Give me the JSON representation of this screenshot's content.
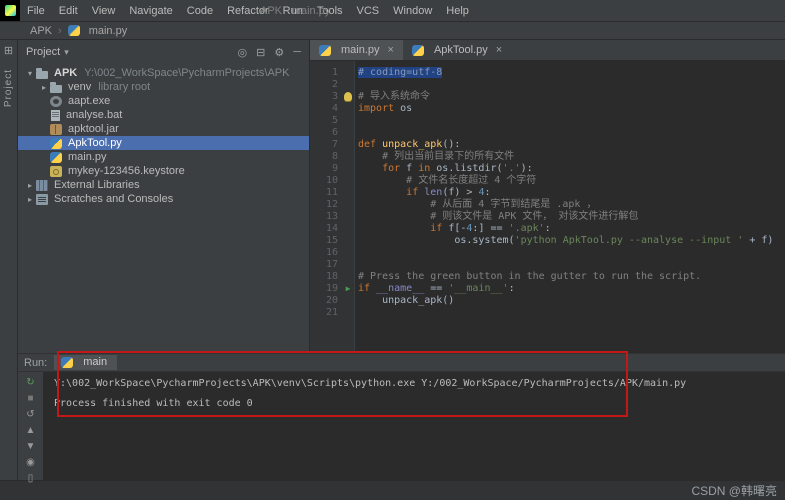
{
  "titlebar": {
    "menus": [
      "File",
      "Edit",
      "View",
      "Navigate",
      "Code",
      "Refactor",
      "Run",
      "Tools",
      "VCS",
      "Window",
      "Help"
    ],
    "title": "APK - main.py"
  },
  "breadcrumb": {
    "items": [
      {
        "label": "APK",
        "icon": null
      },
      {
        "label": "main.py",
        "icon": "python-icon"
      }
    ]
  },
  "toolstrip": {
    "project_label": "Project",
    "tool_windows_glyph": "⊞"
  },
  "project": {
    "title": "Project",
    "caret": "▾",
    "header_icons": [
      {
        "name": "locate-file-icon",
        "glyph": "◎"
      },
      {
        "name": "collapse-all-icon",
        "glyph": "⊟"
      },
      {
        "name": "settings-gear-icon",
        "glyph": "⚙"
      },
      {
        "name": "hide-panel-icon",
        "glyph": "─"
      }
    ],
    "tree": [
      {
        "indent": 0,
        "expand": "▾",
        "icon": "folder",
        "label": "APK",
        "sublabel": "Y:\\002_WorkSpace\\PycharmProjects\\APK",
        "bold": true
      },
      {
        "indent": 1,
        "expand": "▸",
        "icon": "folder",
        "label": "venv",
        "sublabel": "library root"
      },
      {
        "indent": 1,
        "expand": "",
        "icon": "exe",
        "label": "aapt.exe"
      },
      {
        "indent": 1,
        "expand": "",
        "icon": "doc",
        "label": "analyse.bat"
      },
      {
        "indent": 1,
        "expand": "",
        "icon": "jar",
        "label": "apktool.jar"
      },
      {
        "indent": 1,
        "expand": "",
        "icon": "py",
        "label": "ApkTool.py",
        "selected": true
      },
      {
        "indent": 1,
        "expand": "",
        "icon": "py",
        "label": "main.py"
      },
      {
        "indent": 1,
        "expand": "",
        "icon": "key",
        "label": "mykey-123456.keystore"
      },
      {
        "indent": 0,
        "expand": "▸",
        "icon": "lib",
        "label": "External Libraries"
      },
      {
        "indent": 0,
        "expand": "▸",
        "icon": "scratch",
        "label": "Scratches and Consoles"
      }
    ]
  },
  "editor": {
    "tabs": [
      {
        "label": "main.py",
        "icon": "python-icon",
        "active": true,
        "close": "×"
      },
      {
        "label": "ApkTool.py",
        "icon": "python-icon",
        "active": false,
        "close": "×"
      }
    ],
    "markers": {
      "bulb_line": 3,
      "run_line": 19,
      "run_glyph": "▶"
    },
    "lines": [
      [
        [
          "csel",
          "# coding=utf-8"
        ]
      ],
      [],
      [
        [
          "c",
          "# 导入系统命令"
        ]
      ],
      [
        [
          "k",
          "import"
        ],
        [
          "t",
          " os"
        ]
      ],
      [],
      [],
      [
        [
          "k",
          "def "
        ],
        [
          "f",
          "unpack_apk"
        ],
        [
          "t",
          "():"
        ]
      ],
      [
        [
          "c",
          "    # 列出当前目录下的所有文件"
        ]
      ],
      [
        [
          "t",
          "    "
        ],
        [
          "k",
          "for"
        ],
        [
          "t",
          " f "
        ],
        [
          "k",
          "in"
        ],
        [
          "t",
          " os.listdir("
        ],
        [
          "s",
          "'.'"
        ],
        [
          "t",
          "):"
        ]
      ],
      [
        [
          "c",
          "        # 文件名长度超过 4 个字符"
        ]
      ],
      [
        [
          "t",
          "        "
        ],
        [
          "k",
          "if"
        ],
        [
          "t",
          " "
        ],
        [
          "b",
          "len"
        ],
        [
          "t",
          "(f) > "
        ],
        [
          "n",
          "4"
        ],
        [
          "t",
          ":"
        ]
      ],
      [
        [
          "c",
          "            # 从后面 4 字节到结尾是 .apk ，"
        ]
      ],
      [
        [
          "c",
          "            # 则该文件是 APK 文件， 对该文件进行解包"
        ]
      ],
      [
        [
          "t",
          "            "
        ],
        [
          "k",
          "if"
        ],
        [
          "t",
          " f[-"
        ],
        [
          "n",
          "4"
        ],
        [
          "t",
          ":] == "
        ],
        [
          "s",
          "'.apk'"
        ],
        [
          "t",
          ":"
        ]
      ],
      [
        [
          "t",
          "                os.system("
        ],
        [
          "s",
          "'python ApkTool.py --analyse --input '"
        ],
        [
          "t",
          " + f)"
        ]
      ],
      [],
      [],
      [
        [
          "c",
          "# Press the green button in the gutter to run the script."
        ]
      ],
      [
        [
          "k",
          "if"
        ],
        [
          "t",
          " "
        ],
        [
          "d",
          "__name__"
        ],
        [
          "t",
          " == "
        ],
        [
          "s",
          "'__main__'"
        ],
        [
          "t",
          ":"
        ]
      ],
      [
        [
          "t",
          "    unpack_apk()"
        ]
      ],
      []
    ]
  },
  "run": {
    "label": "Run:",
    "tab": {
      "label": "main",
      "icon": "python-icon"
    },
    "toolbar": [
      {
        "name": "rerun-icon",
        "glyph": "↻",
        "color": "#5a9e58"
      },
      {
        "name": "stop-icon",
        "glyph": "■",
        "color": "#777777"
      },
      {
        "name": "restore-layout-icon",
        "glyph": "↺",
        "color": "#9a9a9a"
      },
      {
        "name": "up-stack-trace-icon",
        "glyph": "▲",
        "color": "#9a9a9a"
      },
      {
        "name": "down-stack-trace-icon",
        "glyph": "▼",
        "color": "#9a9a9a"
      },
      {
        "name": "pin-icon",
        "glyph": "◉",
        "color": "#9a9a9a"
      },
      {
        "name": "clear-console-icon",
        "glyph": "▯",
        "color": "#9a9a9a"
      }
    ],
    "output": [
      "Y:\\002_WorkSpace\\PycharmProjects\\APK\\venv\\Scripts\\python.exe Y:/002_WorkSpace/PycharmProjects/APK/main.py",
      "",
      "Process finished with exit code 0"
    ]
  },
  "annotation": {
    "color": "#c41818"
  },
  "watermark": "CSDN @韩曙亮"
}
